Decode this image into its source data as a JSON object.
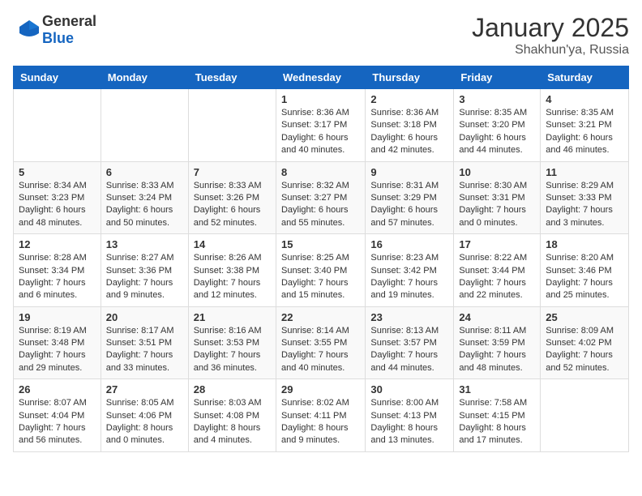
{
  "logo": {
    "general": "General",
    "blue": "Blue"
  },
  "header": {
    "month": "January 2025",
    "location": "Shakhun'ya, Russia"
  },
  "days": [
    "Sunday",
    "Monday",
    "Tuesday",
    "Wednesday",
    "Thursday",
    "Friday",
    "Saturday"
  ],
  "weeks": [
    [
      {
        "day": "",
        "content": ""
      },
      {
        "day": "",
        "content": ""
      },
      {
        "day": "",
        "content": ""
      },
      {
        "day": "1",
        "content": "Sunrise: 8:36 AM\nSunset: 3:17 PM\nDaylight: 6 hours\nand 40 minutes."
      },
      {
        "day": "2",
        "content": "Sunrise: 8:36 AM\nSunset: 3:18 PM\nDaylight: 6 hours\nand 42 minutes."
      },
      {
        "day": "3",
        "content": "Sunrise: 8:35 AM\nSunset: 3:20 PM\nDaylight: 6 hours\nand 44 minutes."
      },
      {
        "day": "4",
        "content": "Sunrise: 8:35 AM\nSunset: 3:21 PM\nDaylight: 6 hours\nand 46 minutes."
      }
    ],
    [
      {
        "day": "5",
        "content": "Sunrise: 8:34 AM\nSunset: 3:23 PM\nDaylight: 6 hours\nand 48 minutes."
      },
      {
        "day": "6",
        "content": "Sunrise: 8:33 AM\nSunset: 3:24 PM\nDaylight: 6 hours\nand 50 minutes."
      },
      {
        "day": "7",
        "content": "Sunrise: 8:33 AM\nSunset: 3:26 PM\nDaylight: 6 hours\nand 52 minutes."
      },
      {
        "day": "8",
        "content": "Sunrise: 8:32 AM\nSunset: 3:27 PM\nDaylight: 6 hours\nand 55 minutes."
      },
      {
        "day": "9",
        "content": "Sunrise: 8:31 AM\nSunset: 3:29 PM\nDaylight: 6 hours\nand 57 minutes."
      },
      {
        "day": "10",
        "content": "Sunrise: 8:30 AM\nSunset: 3:31 PM\nDaylight: 7 hours\nand 0 minutes."
      },
      {
        "day": "11",
        "content": "Sunrise: 8:29 AM\nSunset: 3:33 PM\nDaylight: 7 hours\nand 3 minutes."
      }
    ],
    [
      {
        "day": "12",
        "content": "Sunrise: 8:28 AM\nSunset: 3:34 PM\nDaylight: 7 hours\nand 6 minutes."
      },
      {
        "day": "13",
        "content": "Sunrise: 8:27 AM\nSunset: 3:36 PM\nDaylight: 7 hours\nand 9 minutes."
      },
      {
        "day": "14",
        "content": "Sunrise: 8:26 AM\nSunset: 3:38 PM\nDaylight: 7 hours\nand 12 minutes."
      },
      {
        "day": "15",
        "content": "Sunrise: 8:25 AM\nSunset: 3:40 PM\nDaylight: 7 hours\nand 15 minutes."
      },
      {
        "day": "16",
        "content": "Sunrise: 8:23 AM\nSunset: 3:42 PM\nDaylight: 7 hours\nand 19 minutes."
      },
      {
        "day": "17",
        "content": "Sunrise: 8:22 AM\nSunset: 3:44 PM\nDaylight: 7 hours\nand 22 minutes."
      },
      {
        "day": "18",
        "content": "Sunrise: 8:20 AM\nSunset: 3:46 PM\nDaylight: 7 hours\nand 25 minutes."
      }
    ],
    [
      {
        "day": "19",
        "content": "Sunrise: 8:19 AM\nSunset: 3:48 PM\nDaylight: 7 hours\nand 29 minutes."
      },
      {
        "day": "20",
        "content": "Sunrise: 8:17 AM\nSunset: 3:51 PM\nDaylight: 7 hours\nand 33 minutes."
      },
      {
        "day": "21",
        "content": "Sunrise: 8:16 AM\nSunset: 3:53 PM\nDaylight: 7 hours\nand 36 minutes."
      },
      {
        "day": "22",
        "content": "Sunrise: 8:14 AM\nSunset: 3:55 PM\nDaylight: 7 hours\nand 40 minutes."
      },
      {
        "day": "23",
        "content": "Sunrise: 8:13 AM\nSunset: 3:57 PM\nDaylight: 7 hours\nand 44 minutes."
      },
      {
        "day": "24",
        "content": "Sunrise: 8:11 AM\nSunset: 3:59 PM\nDaylight: 7 hours\nand 48 minutes."
      },
      {
        "day": "25",
        "content": "Sunrise: 8:09 AM\nSunset: 4:02 PM\nDaylight: 7 hours\nand 52 minutes."
      }
    ],
    [
      {
        "day": "26",
        "content": "Sunrise: 8:07 AM\nSunset: 4:04 PM\nDaylight: 7 hours\nand 56 minutes."
      },
      {
        "day": "27",
        "content": "Sunrise: 8:05 AM\nSunset: 4:06 PM\nDaylight: 8 hours\nand 0 minutes."
      },
      {
        "day": "28",
        "content": "Sunrise: 8:03 AM\nSunset: 4:08 PM\nDaylight: 8 hours\nand 4 minutes."
      },
      {
        "day": "29",
        "content": "Sunrise: 8:02 AM\nSunset: 4:11 PM\nDaylight: 8 hours\nand 9 minutes."
      },
      {
        "day": "30",
        "content": "Sunrise: 8:00 AM\nSunset: 4:13 PM\nDaylight: 8 hours\nand 13 minutes."
      },
      {
        "day": "31",
        "content": "Sunrise: 7:58 AM\nSunset: 4:15 PM\nDaylight: 8 hours\nand 17 minutes."
      },
      {
        "day": "",
        "content": ""
      }
    ]
  ]
}
